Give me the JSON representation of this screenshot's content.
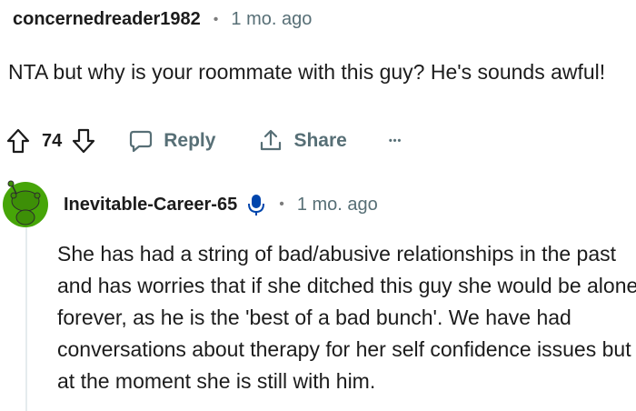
{
  "comment1": {
    "username": "concernedreader1982",
    "separator": "•",
    "time": "1 mo. ago",
    "body": "NTA but why is your roommate with this guy? He's sounds awful!",
    "votes": "74",
    "reply_label": "Reply",
    "share_label": "Share",
    "more_label": "•••"
  },
  "comment2": {
    "username": "Inevitable-Career-65",
    "separator": "•",
    "time": "1 mo. ago",
    "body": "She has had a string of bad/abusive relationships in the past and has worries that if she ditched this guy she would be alone forever, as he is the 'best of a bad bunch'. We have had conversations about therapy for her self confidence issues but at the moment she is still with him.",
    "avatar_color": "#46a508"
  },
  "colors": {
    "text": "#1c1c1c",
    "muted": "#576f76",
    "mic_badge": "#0045ac"
  }
}
